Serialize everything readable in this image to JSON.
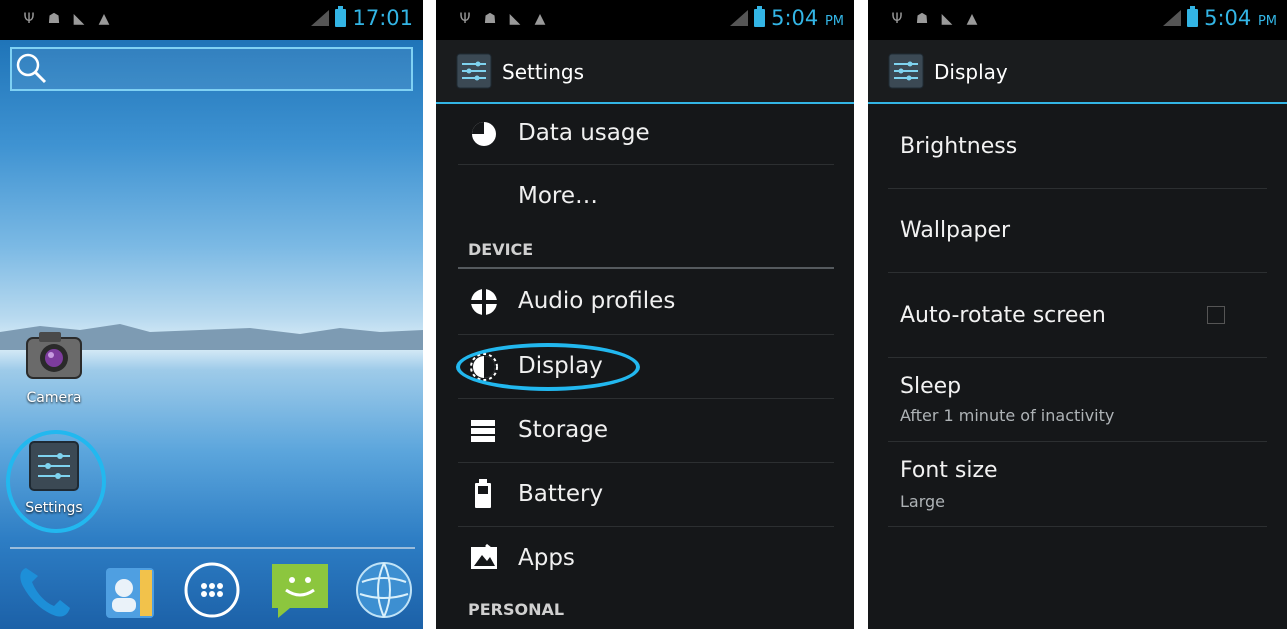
{
  "home": {
    "time": "17:01",
    "apps": [
      {
        "label": "Camera"
      },
      {
        "label": "Settings"
      }
    ]
  },
  "settings": {
    "time": "5:04",
    "time_suffix": "PM",
    "title": "Settings",
    "items_top": [
      {
        "label": "Data usage",
        "icon": "pie-icon"
      },
      {
        "label": "More…",
        "icon": ""
      }
    ],
    "section_device": "DEVICE",
    "items_device": [
      {
        "label": "Audio profiles",
        "icon": "audio-profiles-icon"
      },
      {
        "label": "Display",
        "icon": "display-icon"
      },
      {
        "label": "Storage",
        "icon": "storage-icon"
      },
      {
        "label": "Battery",
        "icon": "battery-icon"
      },
      {
        "label": "Apps",
        "icon": "apps-icon"
      }
    ],
    "section_personal": "PERSONAL"
  },
  "display": {
    "time": "5:04",
    "time_suffix": "PM",
    "title": "Display",
    "items": [
      {
        "title": "Brightness",
        "summary": ""
      },
      {
        "title": "Wallpaper",
        "summary": ""
      },
      {
        "title": "Auto-rotate screen",
        "summary": "",
        "checked": false
      },
      {
        "title": "Sleep",
        "summary": "After 1 minute of inactivity"
      },
      {
        "title": "Font size",
        "summary": "Large"
      }
    ]
  },
  "colors": {
    "accent": "#33b5e5",
    "highlight": "#22b8ef"
  }
}
